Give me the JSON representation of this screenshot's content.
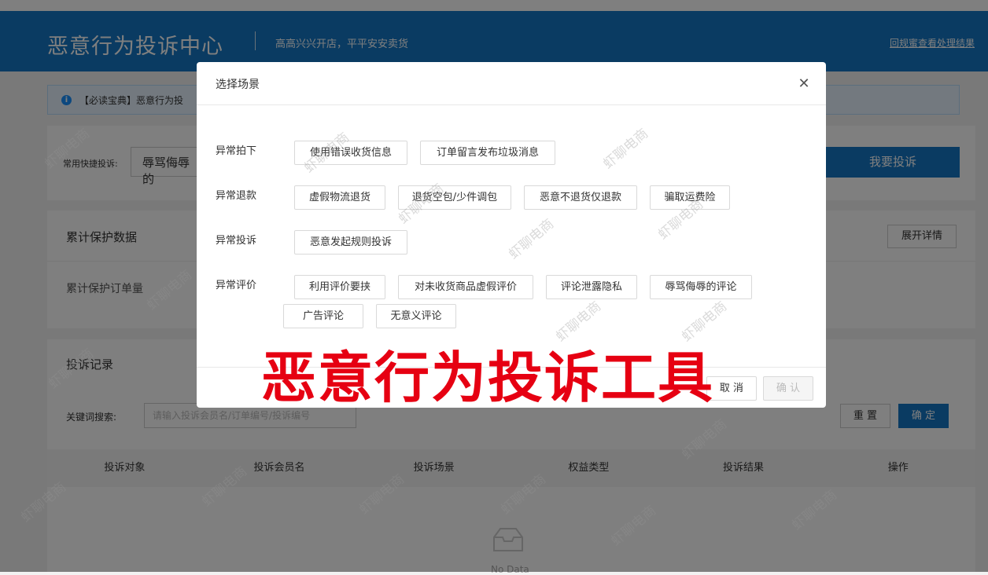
{
  "header": {
    "title": "恶意行为投诉中心",
    "slogan": "高高兴兴开店，平平安安卖货",
    "link": "回规蜜查看处理结果"
  },
  "notice": {
    "icon": "info-icon",
    "text": "【必读宝典】恶意行为投"
  },
  "quick": {
    "label": "常用快捷投诉:",
    "input_value": "辱骂侮辱的",
    "complain_button": "我要投诉"
  },
  "stats": {
    "title": "累计保护数据",
    "expand_button": "展开详情",
    "orders_label": "累计保护订单量"
  },
  "records": {
    "title": "投诉记录",
    "keyword_label": "关键词搜索:",
    "keyword_placeholder": "请输入投诉会员名/订单编号/投诉编号",
    "reset_button": "重 置",
    "ok_button": "确 定",
    "columns": [
      "投诉对象",
      "投诉会员名",
      "投诉场景",
      "权益类型",
      "投诉结果",
      "操作"
    ],
    "empty_text": "No Data"
  },
  "modal": {
    "title": "选择场景",
    "close_icon": "close-icon",
    "groups": [
      {
        "label": "异常拍下",
        "tags": [
          "使用错误收货信息",
          "订单留言发布垃圾消息"
        ]
      },
      {
        "label": "异常退款",
        "tags": [
          "虚假物流退货",
          "退货空包/少件调包",
          "恶意不退货仅退款",
          "骗取运费险"
        ]
      },
      {
        "label": "异常投诉",
        "tags": [
          "恶意发起规则投诉"
        ]
      },
      {
        "label": "异常评价",
        "tags": [
          "利用评价要挟",
          "对未收货商品虚假评价",
          "评论泄露隐私",
          "辱骂侮辱的评论",
          "广告评论",
          "无意义评论"
        ]
      }
    ],
    "cancel_button": "取 消",
    "confirm_button": "确 认"
  },
  "overlay_caption": "恶意行为投诉工具",
  "watermark": "虾聊电商",
  "colors": {
    "brand_blue": "#1577c4",
    "caption_red": "#e60012"
  }
}
